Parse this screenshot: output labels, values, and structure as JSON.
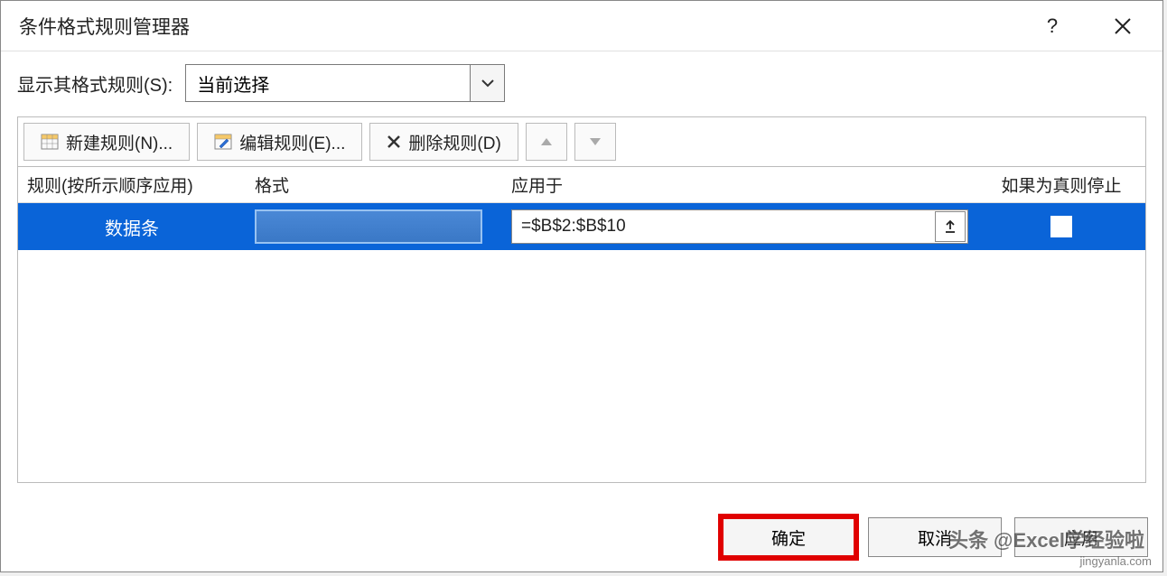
{
  "dialog": {
    "title": "条件格式规则管理器",
    "help_tooltip": "?",
    "close_tooltip": "关闭"
  },
  "show_rules": {
    "label": "显示其格式规则(S):",
    "selected": "当前选择"
  },
  "toolbar": {
    "new_rule": "新建规则(N)...",
    "edit_rule": "编辑规则(E)...",
    "delete_rule": "删除规则(D)"
  },
  "columns": {
    "rule": "规则(按所示顺序应用)",
    "format": "格式",
    "applies_to": "应用于",
    "stop_if_true": "如果为真则停止"
  },
  "rules": [
    {
      "name": "数据条",
      "applies_to": "=$B$2:$B$10",
      "stop": false
    }
  ],
  "footer": {
    "ok": "确定",
    "cancel": "取消",
    "apply": "应用"
  },
  "watermark": "头条 @Excel学经验啦",
  "watermark2": "jingyanla.com"
}
